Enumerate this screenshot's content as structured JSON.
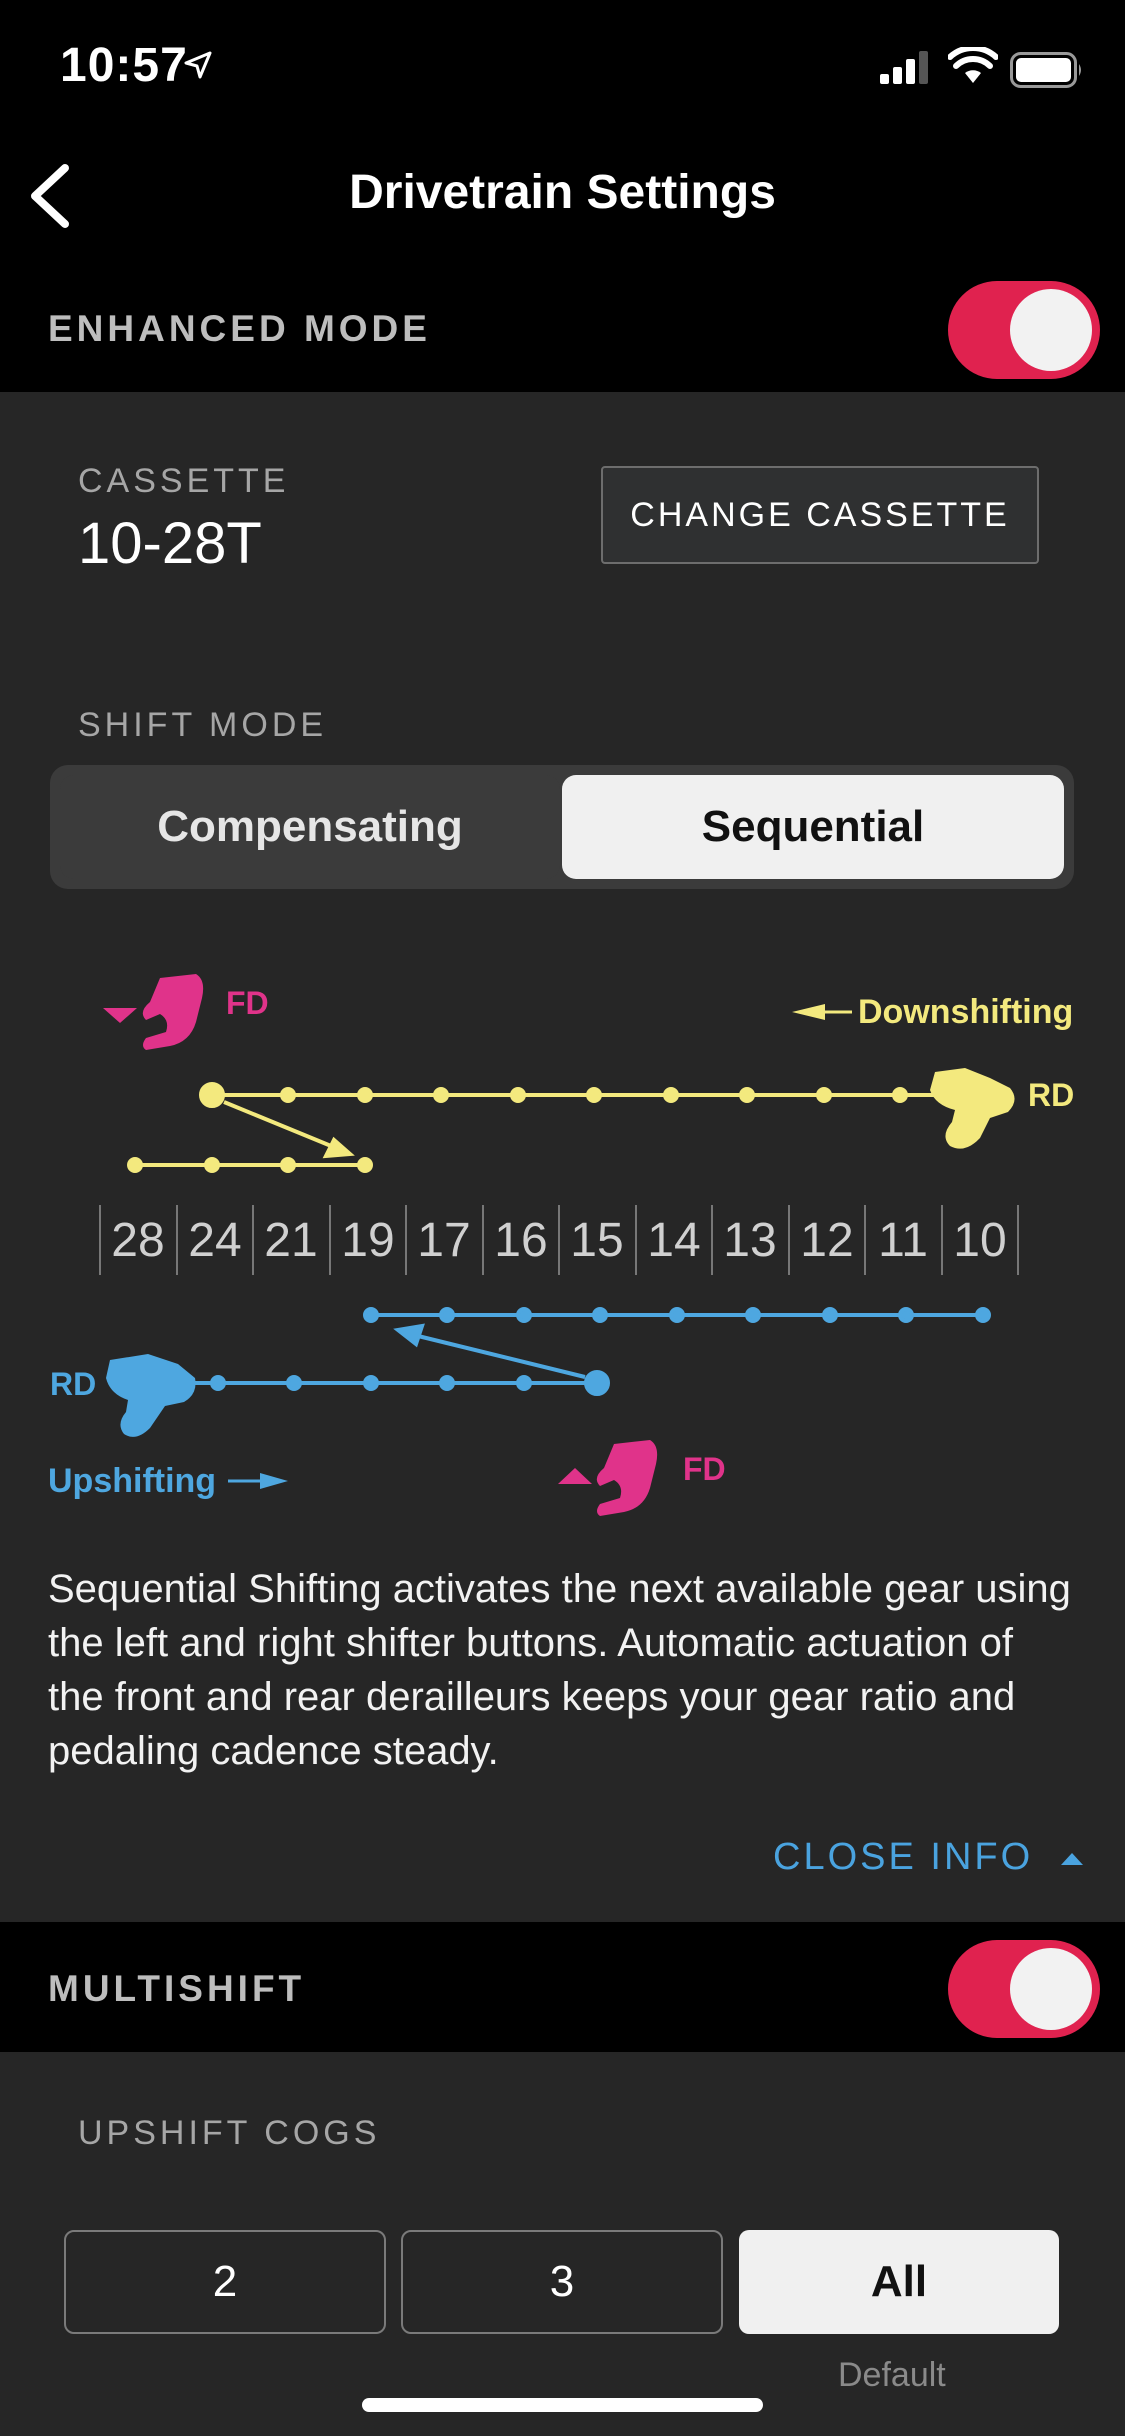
{
  "status": {
    "time": "10:57"
  },
  "nav": {
    "title": "Drivetrain Settings"
  },
  "enhanced_mode": {
    "label": "ENHANCED MODE",
    "on": true
  },
  "cassette": {
    "label": "CASSETTE",
    "value": "10-28T",
    "change_label": "CHANGE CASSETTE"
  },
  "shift_mode": {
    "label": "SHIFT MODE",
    "options": [
      "Compensating",
      "Sequential"
    ],
    "selected": "Sequential"
  },
  "diagram": {
    "cogs": [
      "28",
      "24",
      "21",
      "19",
      "17",
      "16",
      "15",
      "14",
      "13",
      "12",
      "11",
      "10"
    ],
    "downshift_label": "Downshifting",
    "upshift_label": "Upshifting",
    "fd_label": "FD",
    "rd_label": "RD"
  },
  "info_text": "Sequential Shifting activates the next available gear using the left and right shifter buttons. Automatic actuation of the front and rear derailleurs keeps your gear ratio and pedaling cadence steady.",
  "close_info_label": "CLOSE INFO",
  "multishift": {
    "label": "MULTISHIFT",
    "on": true
  },
  "upshift_cogs": {
    "label": "UPSHIFT COGS",
    "options": [
      "2",
      "3",
      "All"
    ],
    "selected": "All",
    "default_note": "Default"
  },
  "colors": {
    "accent_toggle": "#e0224f",
    "downshift": "#f3e97e",
    "upshift": "#4ea7e0",
    "fd": "#e0338a",
    "link": "#4aa3df"
  }
}
